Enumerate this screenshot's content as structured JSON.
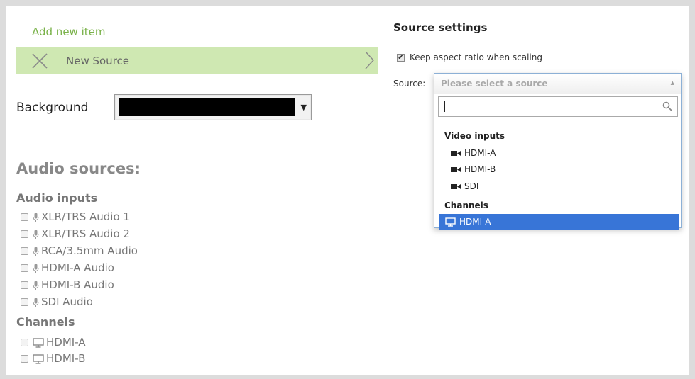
{
  "left": {
    "add_new_item": "Add new item",
    "source_item_label": "New Source",
    "background_label": "Background",
    "background_color": "#000000",
    "audio_sources_title": "Audio sources:",
    "audio_inputs_heading": "Audio inputs",
    "audio_inputs": [
      {
        "label": "XLR/TRS Audio 1",
        "checked": false
      },
      {
        "label": "XLR/TRS Audio 2",
        "checked": false
      },
      {
        "label": "RCA/3.5mm Audio",
        "checked": false
      },
      {
        "label": "HDMI-A Audio",
        "checked": false
      },
      {
        "label": "HDMI-B Audio",
        "checked": false
      },
      {
        "label": "SDI Audio",
        "checked": false
      }
    ],
    "channels_heading": "Channels",
    "channels": [
      {
        "label": "HDMI-A",
        "checked": false
      },
      {
        "label": "HDMI-B",
        "checked": false
      }
    ]
  },
  "right": {
    "title": "Source settings",
    "keep_aspect_label": "Keep aspect ratio when scaling",
    "keep_aspect_checked": true,
    "source_label": "Source:",
    "source_placeholder": "Please select a source",
    "search_value": "",
    "groups": [
      {
        "name": "Video inputs",
        "options": [
          "HDMI-A",
          "HDMI-B",
          "SDI"
        ],
        "icon": "video-camera-icon"
      },
      {
        "name": "Channels",
        "options": [
          "HDMI-A"
        ],
        "icon": "monitor-icon"
      }
    ],
    "selected_option": "HDMI-A"
  },
  "colors": {
    "accent_green": "#7ab24a",
    "row_green": "#cfe8b2",
    "selection_blue": "#3875d7"
  }
}
